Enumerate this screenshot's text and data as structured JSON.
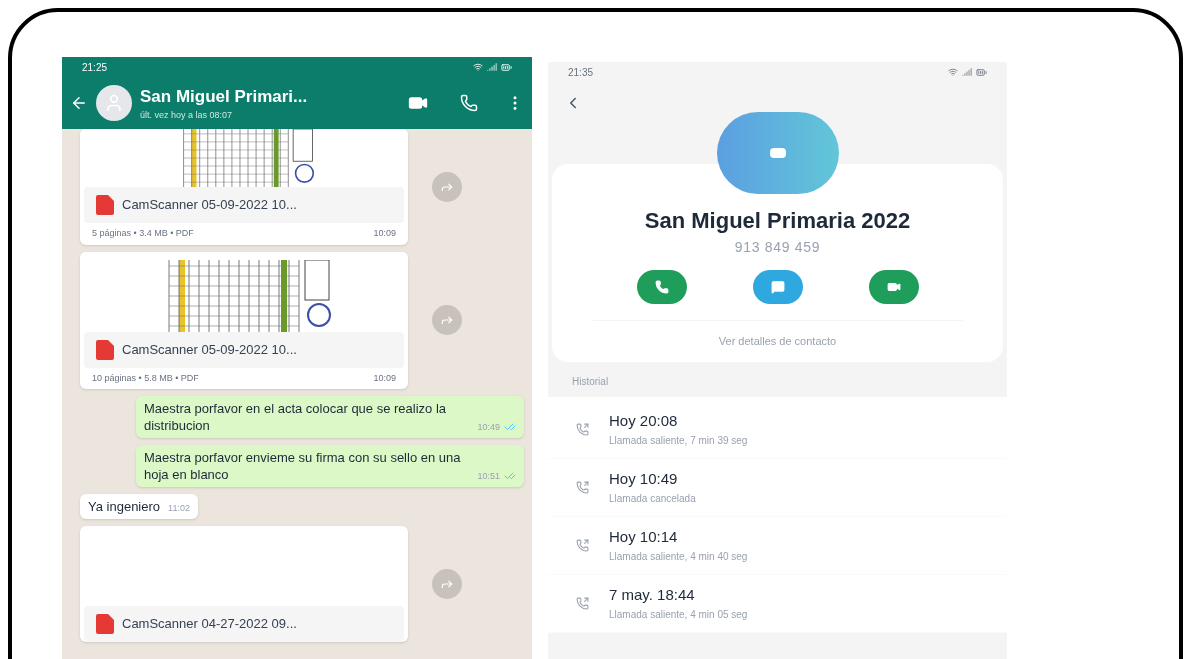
{
  "chat_screen": {
    "status_bar": {
      "time": "21:25"
    },
    "header": {
      "title": "San Miguel Primari...",
      "subtitle": "últ. vez hoy a las 08:07"
    },
    "messages": [
      {
        "kind": "document",
        "outgoing": false,
        "scanned": true,
        "cropped": true,
        "filename": "CamScanner 05-09-2022 10...",
        "meta": "5 páginas • 3.4 MB • PDF",
        "time": "10:09"
      },
      {
        "kind": "document",
        "outgoing": false,
        "scanned": true,
        "filename": "CamScanner 05-09-2022 10...",
        "meta": "10 páginas • 5.8 MB • PDF",
        "time": "10:09"
      },
      {
        "kind": "text",
        "outgoing": true,
        "text": "Maestra porfavor en el acta colocar que se realizo la distribucion",
        "time": "10:49",
        "read": true
      },
      {
        "kind": "text",
        "outgoing": true,
        "text": "Maestra porfavor envieme su firma con su sello en una hoja en blanco",
        "time": "10:51",
        "read": true
      },
      {
        "kind": "text",
        "outgoing": false,
        "text": "Ya ingeniero",
        "time": "11:02"
      },
      {
        "kind": "document",
        "outgoing": false,
        "scanned": false,
        "filename": "CamScanner 04-27-2022 09..."
      }
    ]
  },
  "contact_screen": {
    "status_bar": {
      "time": "21:35"
    },
    "name": "San Miguel Primaria 2022",
    "phone": "913 849 459",
    "actions": [
      {
        "kind": "call"
      },
      {
        "kind": "message"
      },
      {
        "kind": "video"
      }
    ],
    "details_link": "Ver detalles de contacto",
    "history": {
      "title": "Historial",
      "calls": [
        {
          "when": "Hoy 20:08",
          "detail": "Llamada saliente, 7 min 39 seg"
        },
        {
          "when": "Hoy 10:49",
          "detail": "Llamada cancelada"
        },
        {
          "when": "Hoy 10:14",
          "detail": "Llamada saliente, 4 min 40 seg"
        },
        {
          "when": "7 may. 18:44",
          "detail": "Llamada saliente, 4 min 05 seg"
        }
      ]
    }
  }
}
